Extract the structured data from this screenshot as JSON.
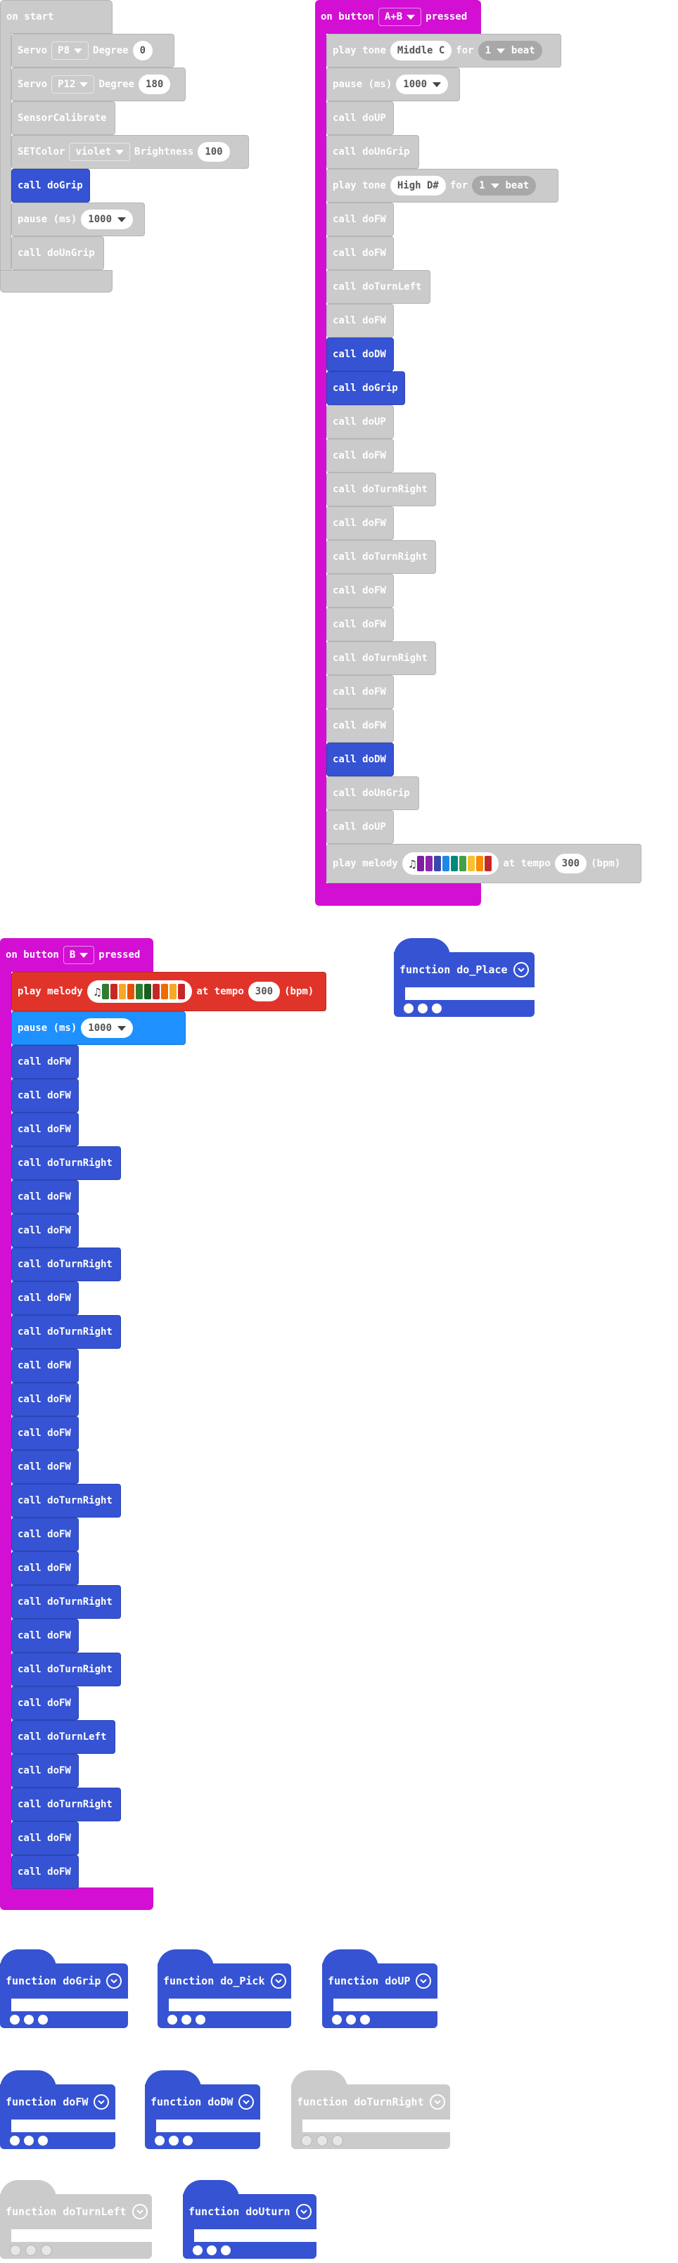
{
  "colors": {
    "magenta": "#d20fd2",
    "blue": "#3553d3",
    "gray": "#cbcbcb",
    "red": "#e0342b",
    "light_blue": "#1e90ff"
  },
  "on_start": {
    "title": "on start",
    "servo1": {
      "label": "Servo",
      "pin": "P8",
      "degree_label": "Degree",
      "degree": "0"
    },
    "servo2": {
      "label": "Servo",
      "pin": "P12",
      "degree_label": "Degree",
      "degree": "180"
    },
    "sensor": "SensorCalibrate",
    "setcolor": {
      "label": "SETColor",
      "color": "violet",
      "brightness_label": "Brightness",
      "brightness": "100"
    },
    "call_grip": "call doGrip",
    "pause": {
      "label": "pause (ms)",
      "value": "1000"
    },
    "call_ungrip": "call doUnGrip"
  },
  "button_ab": {
    "on_label": "on button",
    "button": "A+B",
    "pressed_label": "pressed",
    "tone1": {
      "label": "play tone",
      "note": "Middle C",
      "for_label": "for",
      "beat": "1",
      "beat_label": "beat"
    },
    "pause": {
      "label": "pause (ms)",
      "value": "1000"
    },
    "call_up_1": "call doUP",
    "call_ungrip_1": "call doUnGrip",
    "tone2": {
      "label": "play tone",
      "note": "High D#",
      "for_label": "for",
      "beat": "1",
      "beat_label": "beat"
    },
    "calls_a": [
      "call doFW",
      "call doFW",
      "call doTurnLeft",
      "call doFW"
    ],
    "call_dw_1": "call doDW",
    "call_grip": "call doGrip",
    "calls_b": [
      "call doUP",
      "call doFW",
      "call doTurnRight",
      "call doFW",
      "call doTurnRight",
      "call doFW",
      "call doFW",
      "call doTurnRight",
      "call doFW",
      "call doFW"
    ],
    "call_dw_2": "call doDW",
    "call_ungrip_2": "call doUnGrip",
    "call_up_2": "call doUP",
    "melody": {
      "label": "play melody",
      "tempo_label": "at tempo",
      "tempo": "300",
      "bpm": "(bpm)"
    }
  },
  "button_b": {
    "on_label": "on button",
    "button": "B",
    "pressed_label": "pressed",
    "melody": {
      "label": "play melody",
      "tempo_label": "at tempo",
      "tempo": "300",
      "bpm": "(bpm)"
    },
    "pause": {
      "label": "pause (ms)",
      "value": "1000"
    },
    "calls": [
      "call doFW",
      "call doFW",
      "call doFW",
      "call doTurnRight",
      "call doFW",
      "call doFW",
      "call doTurnRight",
      "call doFW",
      "call doTurnRight",
      "call doFW",
      "call doFW",
      "call doFW",
      "call doFW",
      "call doTurnRight",
      "call doFW",
      "call doFW",
      "call doTurnRight",
      "call doFW",
      "call doTurnRight",
      "call doFW",
      "call doTurnLeft",
      "call doFW",
      "call doTurnRight",
      "call doFW",
      "call doFW"
    ]
  },
  "functions": {
    "do_place": "function do_Place",
    "dogrip": "function doGrip",
    "do_pick": "function do_Pick",
    "doup": "function doUP",
    "dofw": "function doFW",
    "dodw": "function doDW",
    "doturnright": "function doTurnRight",
    "doturnleft": "function doTurnLeft",
    "douturn": "function doUturn"
  },
  "icons": {
    "music": "music-note-icon",
    "chevron": "chevron-down-circle-icon",
    "caret": "caret-down-icon",
    "more": "ellipsis-dots-icon"
  }
}
